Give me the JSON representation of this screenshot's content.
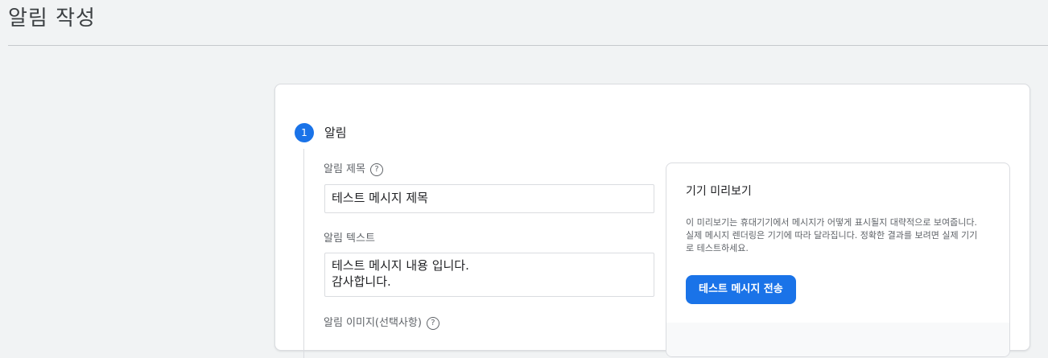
{
  "page": {
    "title": "알림 작성"
  },
  "step": {
    "number": "1",
    "title": "알림",
    "help_glyph": "?",
    "fields": {
      "title_label": "알림 제목",
      "title_value": "테스트 메시지 제목",
      "text_label": "알림 텍스트",
      "text_value": "테스트 메시지 내용 입니다.\n감사합니다.",
      "image_label": "알림 이미지(선택사항)"
    }
  },
  "preview": {
    "title": "기기 미리보기",
    "description": "이 미리보기는 휴대기기에서 메시지가 어떻게 표시될지 대략적으로 보여줍니다. 실제 메시지 렌더링은 기기에 따라 달라집니다. 정확한 결과를 보려면 실제 기기로 테스트하세요.",
    "send_button_label": "테스트 메시지 전송"
  },
  "colors": {
    "accent": "#1a73e8",
    "background": "#f1f3f4"
  },
  "icons": {
    "help": "help-circle-icon"
  }
}
